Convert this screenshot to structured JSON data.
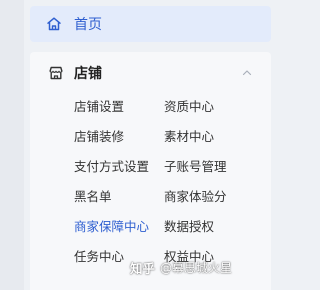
{
  "nav": {
    "home": {
      "label": "首页",
      "icon": "home-icon"
    },
    "store": {
      "title": "店铺",
      "icon": "store-icon",
      "expanded": true,
      "items": [
        {
          "label": "店铺设置",
          "active": false
        },
        {
          "label": "资质中心",
          "active": false
        },
        {
          "label": "店铺装修",
          "active": false
        },
        {
          "label": "素材中心",
          "active": false
        },
        {
          "label": "支付方式设置",
          "active": false
        },
        {
          "label": "子账号管理",
          "active": false
        },
        {
          "label": "黑名单",
          "active": false
        },
        {
          "label": "商家体验分",
          "active": false
        },
        {
          "label": "商家保障中心",
          "active": true
        },
        {
          "label": "数据授权",
          "active": false
        },
        {
          "label": "任务中心",
          "active": false
        },
        {
          "label": "权益中心",
          "active": false
        }
      ]
    }
  },
  "watermark": {
    "brand": "知乎",
    "handle": "@幕思城火星"
  },
  "colors": {
    "accent": "#2f5fd0",
    "home_bg": "#e3ebfb",
    "card_bg": "#f7f8fa",
    "page_bg": "#eef1f5"
  }
}
